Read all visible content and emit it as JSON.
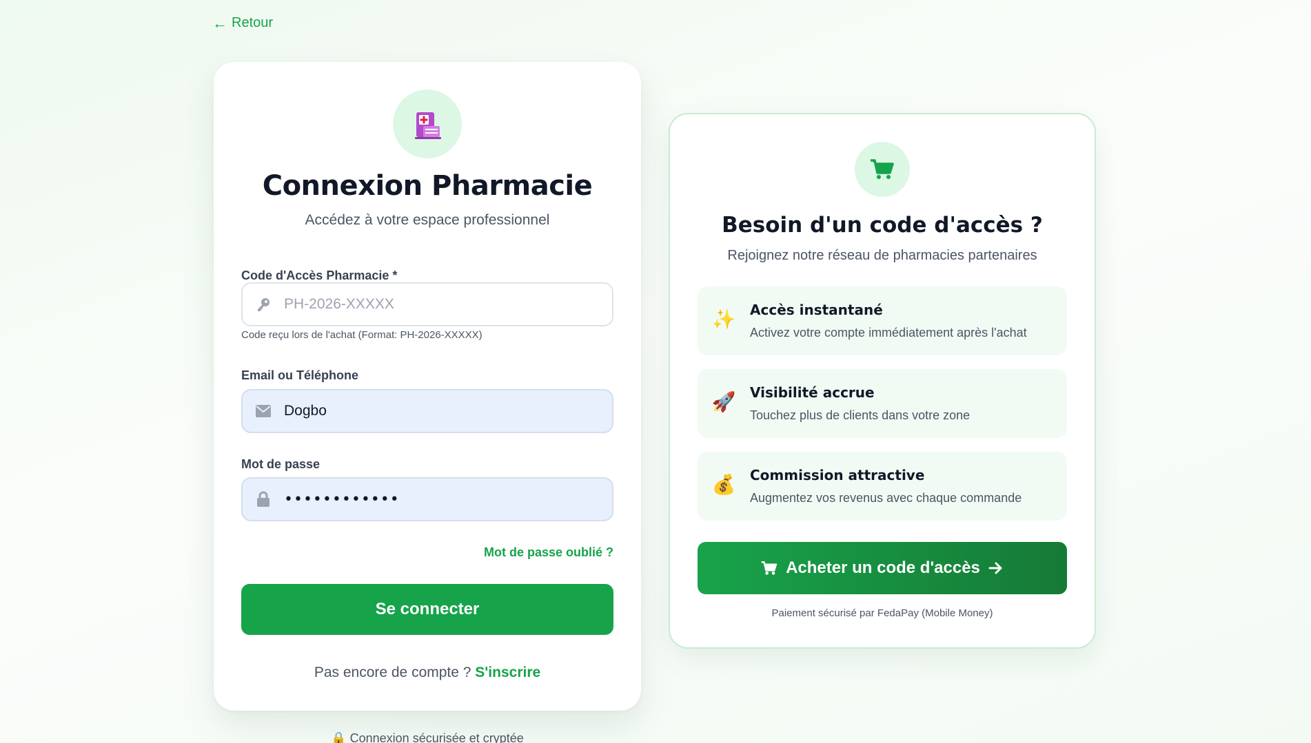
{
  "nav": {
    "back_label": "Retour"
  },
  "login": {
    "title": "Connexion Pharmacie",
    "subtitle": "Accédez à votre espace professionnel",
    "access_code": {
      "label": "Code d'Accès Pharmacie *",
      "placeholder": "PH-2026-XXXXX",
      "value": "",
      "hint": "Code reçu lors de l'achat (Format: PH-2026-XXXXX)",
      "icon": "key-icon"
    },
    "identifier": {
      "label": "Email ou Téléphone",
      "value": "Dogbo",
      "icon": "envelope-icon"
    },
    "password": {
      "label": "Mot de passe",
      "value": "••••••••••••",
      "icon": "lock-icon"
    },
    "forgot_label": "Mot de passe oublié ?",
    "submit_label": "Se connecter",
    "signup_prompt": "Pas encore de compte ?",
    "signup_link": "S'inscrire",
    "logo_icon": "pharmacy-building-icon"
  },
  "secure_note": "🔒 Connexion sécurisée et cryptée",
  "promo": {
    "icon": "cart-icon",
    "title": "Besoin d'un code d'accès ?",
    "subtitle": "Rejoignez notre réseau de pharmacies partenaires",
    "features": [
      {
        "emoji": "✨",
        "icon": "sparkles-icon",
        "title": "Accès instantané",
        "desc": "Activez votre compte immédiatement après l'achat"
      },
      {
        "emoji": "🚀",
        "icon": "rocket-icon",
        "title": "Visibilité accrue",
        "desc": "Touchez plus de clients dans votre zone"
      },
      {
        "emoji": "💰",
        "icon": "money-bag-icon",
        "title": "Commission attractive",
        "desc": "Augmentez vos revenus avec chaque commande"
      }
    ],
    "buy_label": "Acheter un code d'accès",
    "payment_note": "Paiement sécurisé par FedaPay (Mobile Money)"
  },
  "colors": {
    "accent": "#16a34a",
    "accent_dark": "#167a36",
    "icon_bg": "#dcf7e4",
    "feature_bg": "#f1fbf4",
    "filled_input_bg": "#e8f0fe"
  }
}
